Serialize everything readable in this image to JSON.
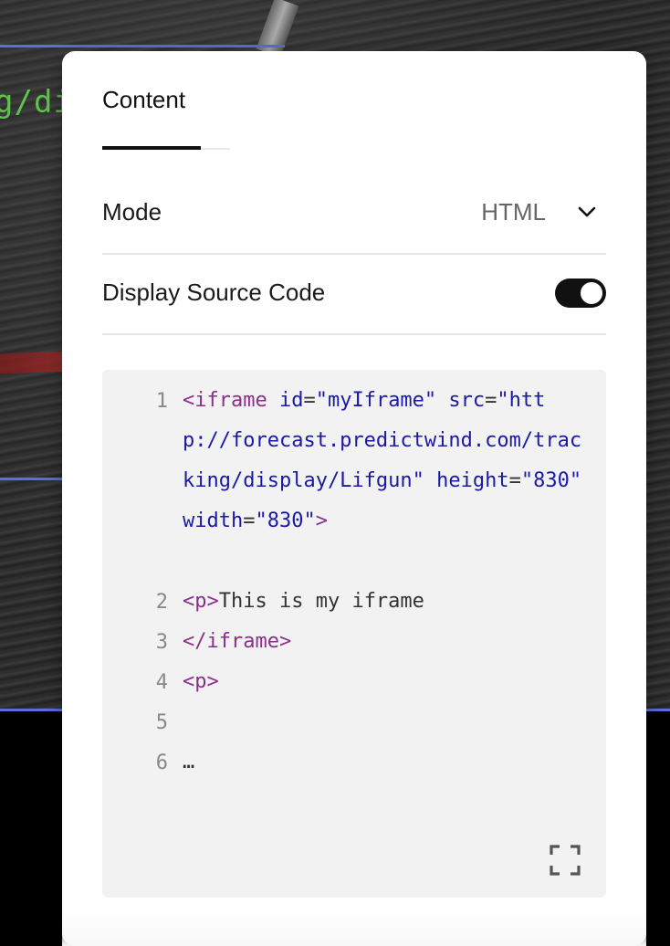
{
  "background": {
    "code_fragment": "g/di"
  },
  "panel": {
    "tab_label": "Content",
    "mode": {
      "label": "Mode",
      "value": "HTML"
    },
    "display_source": {
      "label": "Display Source Code",
      "enabled": true
    },
    "code": {
      "lines": [
        {
          "number": "1"
        },
        {
          "number": "2"
        },
        {
          "number": "3"
        },
        {
          "number": "4"
        },
        {
          "number": "5"
        },
        {
          "number": "6"
        }
      ],
      "line1": {
        "open": "<iframe",
        "id_attr": "id",
        "id_val": "\"myIframe\"",
        "src_attr": "src",
        "src_val": "\"http://forecast.predictwind.com/tracking/display/Lifgun\"",
        "height_attr": "height",
        "height_val": "\"830\"",
        "width_attr": "width",
        "width_val": "\"830\"",
        "close": ">"
      },
      "line2": {
        "tag": "<p>",
        "text": "This is my iframe"
      },
      "line3": {
        "tag": "</iframe>"
      },
      "line4": {
        "tag": "<p>"
      },
      "line6": {
        "text": "…"
      }
    }
  },
  "colors": {
    "accent_line": "#5b6fd6",
    "tag": "#8b2f8b",
    "attr": "#1a1aa6"
  }
}
